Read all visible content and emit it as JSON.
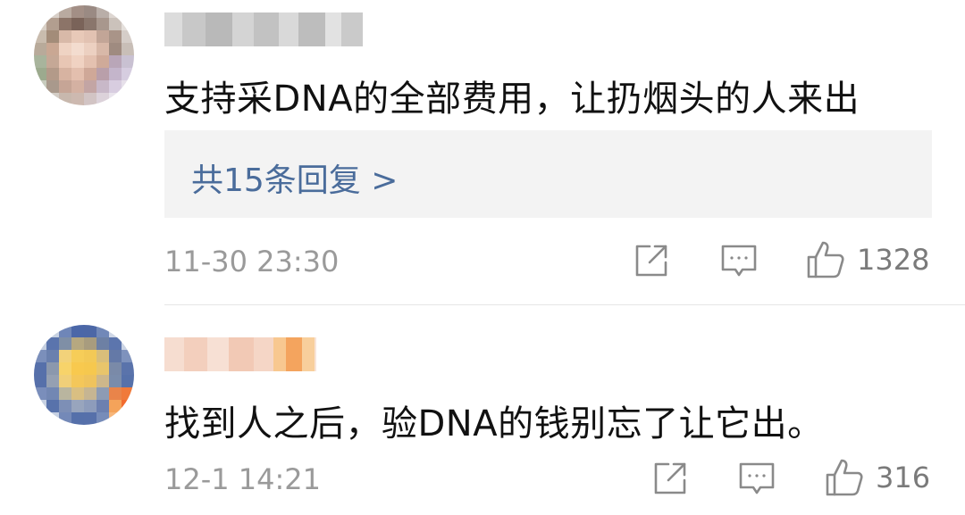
{
  "comments": [
    {
      "text": "支持采DNA的全部费用，让扔烟头的人来出",
      "reply_link": "共15条回复 >",
      "timestamp": "11-30 23:30",
      "like_count": "1328"
    },
    {
      "text": "找到人之后，验DNA的钱别忘了让它出。",
      "timestamp": "12-1 14:21",
      "like_count": "316"
    }
  ],
  "icons": {
    "share": "share-icon",
    "comment": "comment-icon",
    "like": "thumbs-up-icon"
  },
  "colors": {
    "link": "#4a6c9b",
    "text": "#111111",
    "meta": "#9a9a9a",
    "reply_bg": "#f3f3f3"
  }
}
